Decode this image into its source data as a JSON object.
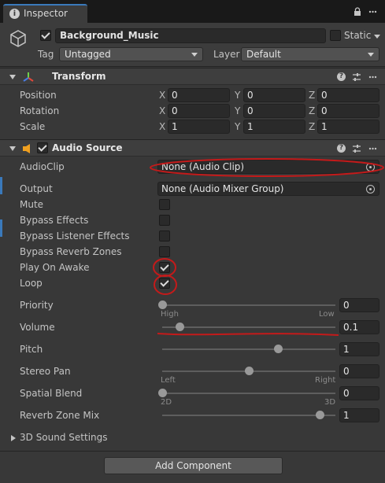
{
  "window": {
    "tab_title": "Inspector",
    "icons": {
      "tab": "info-icon",
      "lock": "lock-icon",
      "menu": "kebab-menu-icon"
    }
  },
  "object": {
    "active": true,
    "name": "Background_Music",
    "static_label": "Static",
    "static_checked": false,
    "tag_label": "Tag",
    "tag_value": "Untagged",
    "layer_label": "Layer",
    "layer_value": "Default"
  },
  "transform": {
    "title": "Transform",
    "rows": [
      {
        "label": "Position",
        "x": "0",
        "y": "0",
        "z": "0"
      },
      {
        "label": "Rotation",
        "x": "0",
        "y": "0",
        "z": "0"
      },
      {
        "label": "Scale",
        "x": "1",
        "y": "1",
        "z": "1"
      }
    ],
    "axis": {
      "x": "X",
      "y": "Y",
      "z": "Z"
    }
  },
  "audio": {
    "title": "Audio Source",
    "enabled": true,
    "audioclip_label": "AudioClip",
    "audioclip_value": "None (Audio Clip)",
    "output_label": "Output",
    "output_value": "None (Audio Mixer Group)",
    "toggles": [
      {
        "label": "Mute",
        "checked": false
      },
      {
        "label": "Bypass Effects",
        "checked": false
      },
      {
        "label": "Bypass Listener Effects",
        "checked": false
      },
      {
        "label": "Bypass Reverb Zones",
        "checked": false
      },
      {
        "label": "Play On Awake",
        "checked": true
      },
      {
        "label": "Loop",
        "checked": true
      }
    ],
    "sliders": [
      {
        "label": "Priority",
        "value": "0",
        "fraction": 0.0,
        "min_label": "High",
        "max_label": "Low"
      },
      {
        "label": "Volume",
        "value": "0.1",
        "fraction": 0.1,
        "min_label": "",
        "max_label": ""
      },
      {
        "label": "Pitch",
        "value": "1",
        "fraction": 0.67,
        "min_label": "",
        "max_label": ""
      },
      {
        "label": "Stereo Pan",
        "value": "0",
        "fraction": 0.5,
        "min_label": "Left",
        "max_label": "Right"
      },
      {
        "label": "Spatial Blend",
        "value": "0",
        "fraction": 0.0,
        "min_label": "2D",
        "max_label": "3D"
      },
      {
        "label": "Reverb Zone Mix",
        "value": "1",
        "fraction": 0.91,
        "min_label": "",
        "max_label": ""
      }
    ],
    "sound_settings_label": "3D Sound Settings"
  },
  "footer": {
    "add_component_label": "Add Component"
  },
  "colors": {
    "accent": "#3a79bb",
    "annotation": "#c41a1a",
    "background": "#383838"
  }
}
